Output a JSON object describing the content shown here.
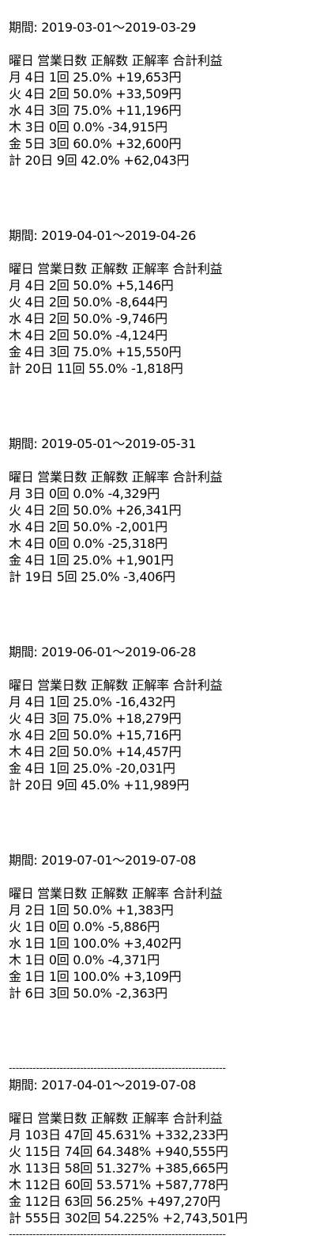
{
  "sections": [
    {
      "period": "期間: 2019-03-01〜2019-03-29",
      "header": "曜日 営業日数 正解数 正解率 合計利益",
      "rows": [
        "月 4日 1回 25.0% +19,653円",
        "火 4日 2回 50.0% +33,509円",
        "水 4日 3回 75.0% +11,196円",
        "木 3日 0回 0.0% -34,915円",
        "金 5日 3回 60.0% +32,600円",
        "計 20日 9回 42.0% +62,043円"
      ]
    },
    {
      "period": "期間: 2019-04-01〜2019-04-26",
      "header": "曜日 営業日数 正解数 正解率 合計利益",
      "rows": [
        "月 4日 2回 50.0% +5,146円",
        "火 4日 2回 50.0% -8,644円",
        "水 4日 2回 50.0% -9,746円",
        "木 4日 2回 50.0% -4,124円",
        "金 4日 3回 75.0% +15,550円",
        "計 20日 11回 55.0% -1,818円"
      ]
    },
    {
      "period": "期間: 2019-05-01〜2019-05-31",
      "header": "曜日 営業日数 正解数 正解率 合計利益",
      "rows": [
        "月 3日 0回 0.0% -4,329円",
        "火 4日 2回 50.0% +26,341円",
        "水 4日 2回 50.0% -2,001円",
        "木 4日 0回 0.0% -25,318円",
        "金 4日 1回 25.0% +1,901円",
        "計 19日 5回 25.0% -3,406円"
      ]
    },
    {
      "period": "期間: 2019-06-01〜2019-06-28",
      "header": "曜日 営業日数 正解数 正解率 合計利益",
      "rows": [
        "月 4日 1回 25.0% -16,432円",
        "火 4日 3回 75.0% +18,279円",
        "水 4日 2回 50.0% +15,716円",
        "木 4日 2回 50.0% +14,457円",
        "金 4日 1回 25.0% -20,031円",
        "計 20日 9回 45.0% +11,989円"
      ]
    },
    {
      "period": "期間: 2019-07-01〜2019-07-08",
      "header": "曜日 営業日数 正解数 正解率 合計利益",
      "rows": [
        "月 2日 1回 50.0% +1,383円",
        "火 1日 0回 0.0% -5,886円",
        "水 1日 1回 100.0% +3,402円",
        "木 1日 0回 0.0% -4,371円",
        "金 1日 1回 100.0% +3,109円",
        "計 6日 3回 50.0% -2,363円"
      ]
    }
  ],
  "separator": "----------------------------------------------------------------",
  "summary": {
    "period": "期間: 2017-04-01〜2019-07-08",
    "header": "曜日 営業日数 正解数 正解率 合計利益",
    "rows": [
      "月 103日 47回 45.631% +332,233円",
      "火 115日 74回 64.348% +940,555円",
      "水 113日 58回 51.327% +385,665円",
      "木 112日 60回 53.571% +587,778円",
      "金 112日 63回 56.25% +497,270円",
      "計 555日 302回 54.225% +2,743,501円"
    ]
  }
}
